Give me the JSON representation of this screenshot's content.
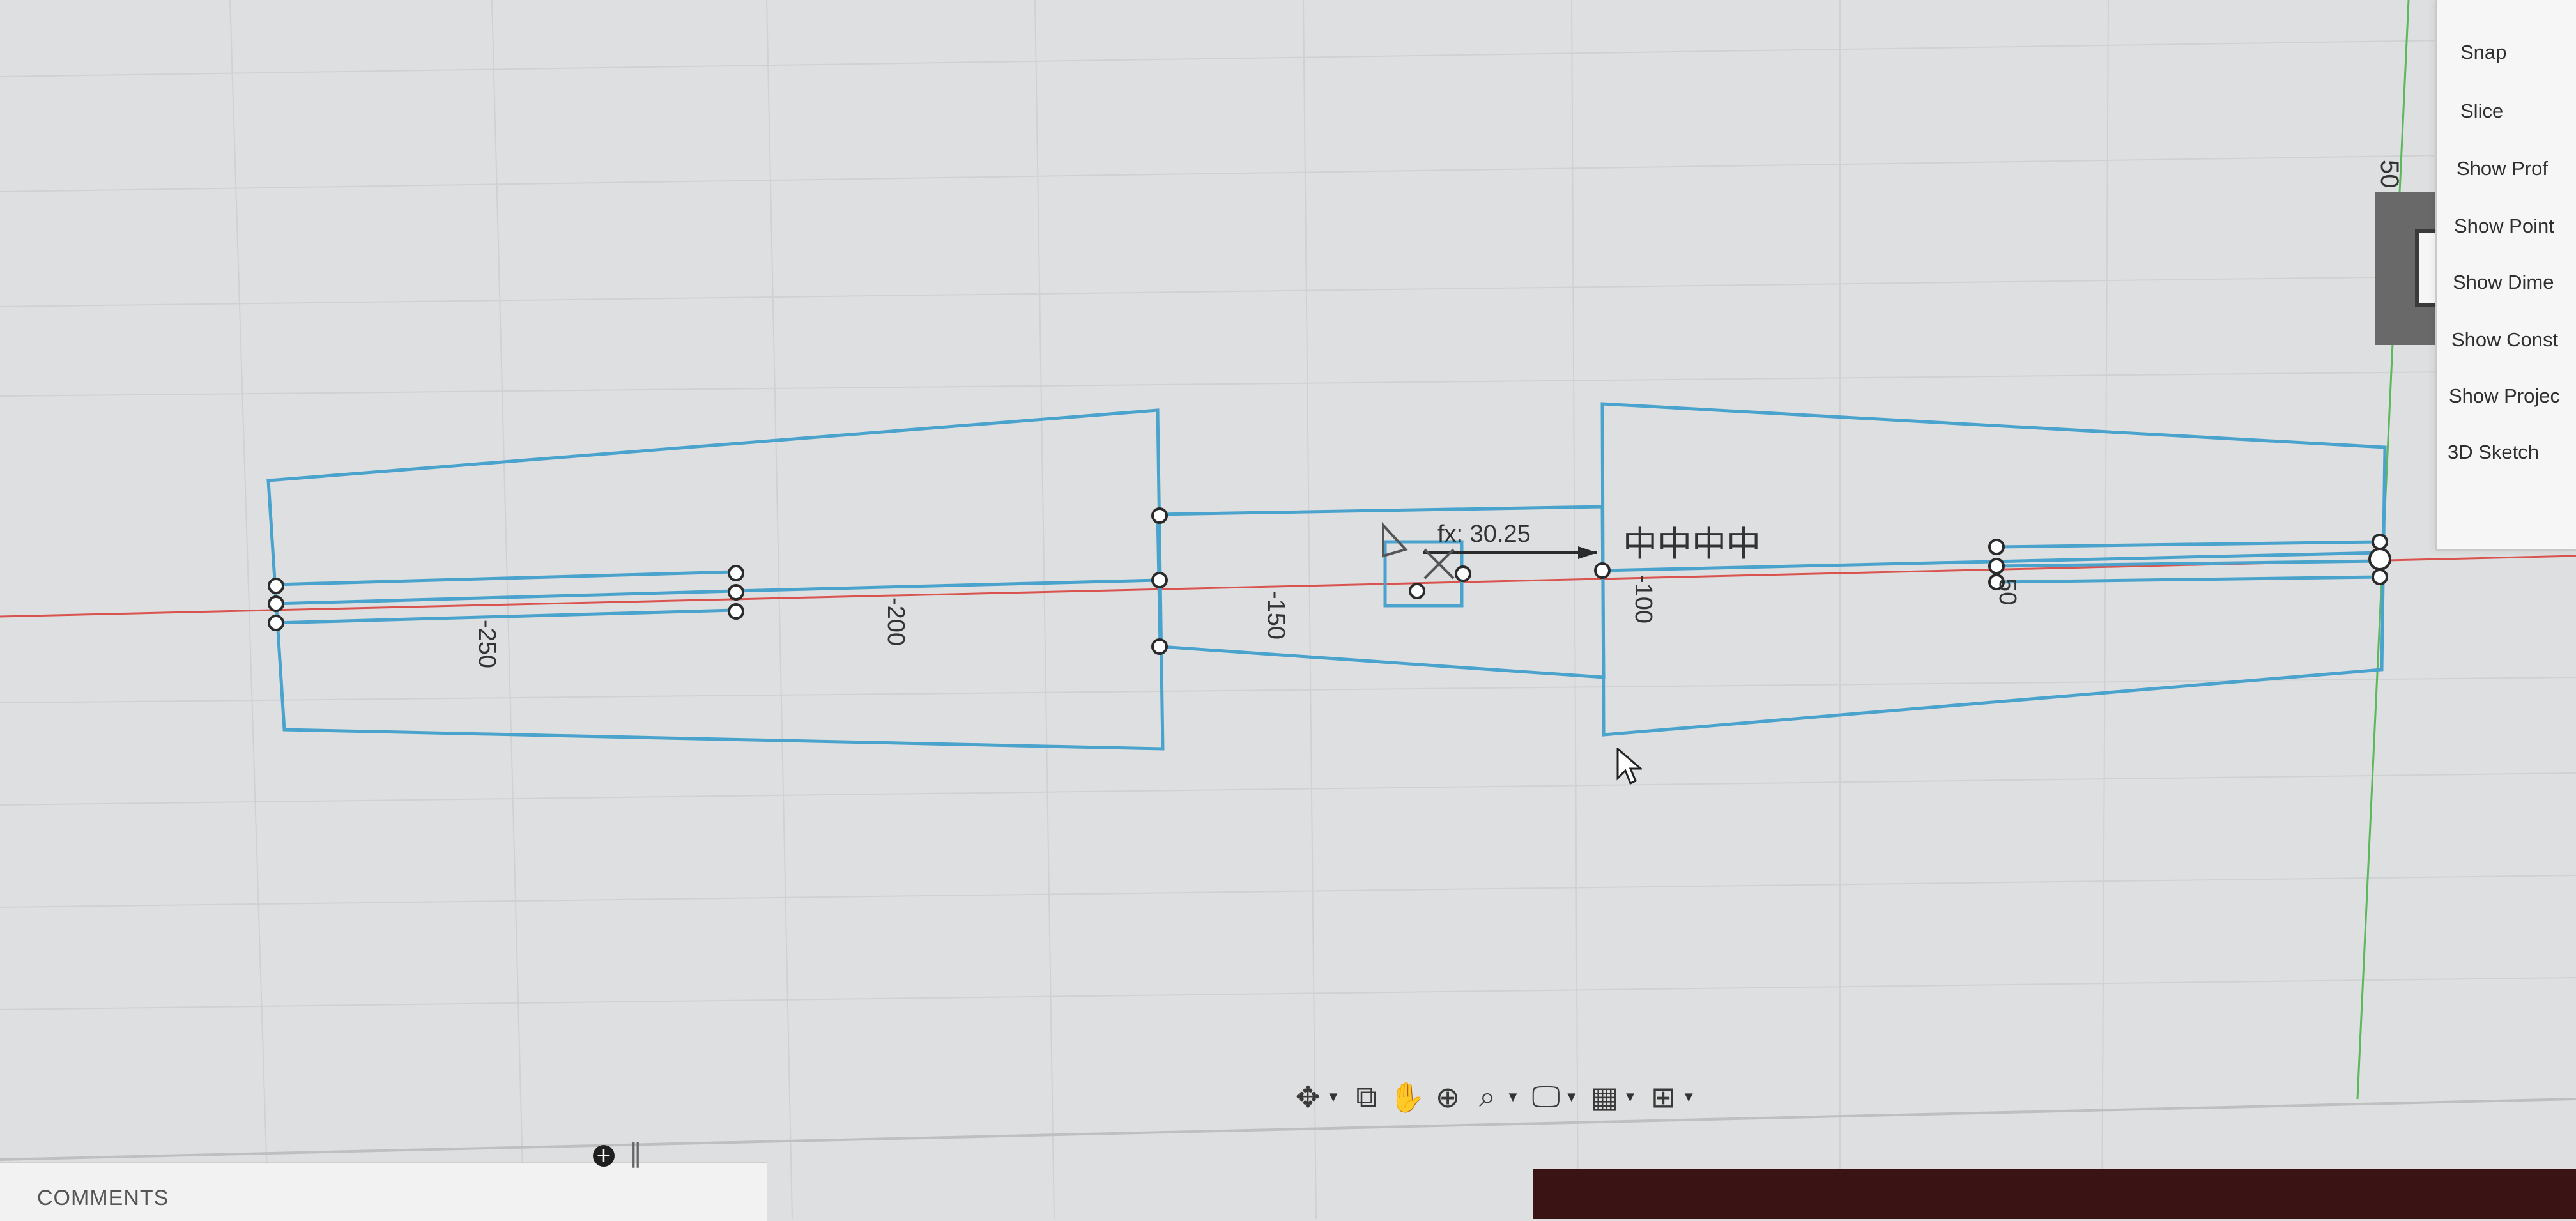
{
  "sketch": {
    "dimensions": {
      "d250": "-250",
      "d200": "-200",
      "d150": "-150",
      "d100": "-100",
      "d50": "50",
      "fx_value": "fx: 30.25"
    },
    "constraint_glyphs": "中中中中"
  },
  "sketch_palette": {
    "items": [
      "Snap",
      "Slice",
      "Show Prof",
      "Show Point",
      "Show Dime",
      "Show Const",
      "Show Projec",
      "3D Sketch"
    ],
    "tab_dimension": "50"
  },
  "navigation_toolbar": {
    "tools": [
      {
        "name": "orbit",
        "icon": "✥"
      },
      {
        "name": "look-at",
        "icon": "⧉"
      },
      {
        "name": "pan",
        "icon": "✋"
      },
      {
        "name": "zoom",
        "icon": "⊕"
      },
      {
        "name": "fit",
        "icon": "⌕"
      },
      {
        "name": "display-settings",
        "icon": "🖵"
      },
      {
        "name": "grid-snaps",
        "icon": "▦"
      },
      {
        "name": "viewports",
        "icon": "⊞"
      }
    ]
  },
  "comments": {
    "label": "COMMENTS",
    "add_icon": "+",
    "handle_icon": "‖"
  },
  "colors": {
    "background": "#dedfe0",
    "sketch_line": "#4aa3cc",
    "x_axis": "#d9534f",
    "y_axis": "#5cb85c"
  }
}
